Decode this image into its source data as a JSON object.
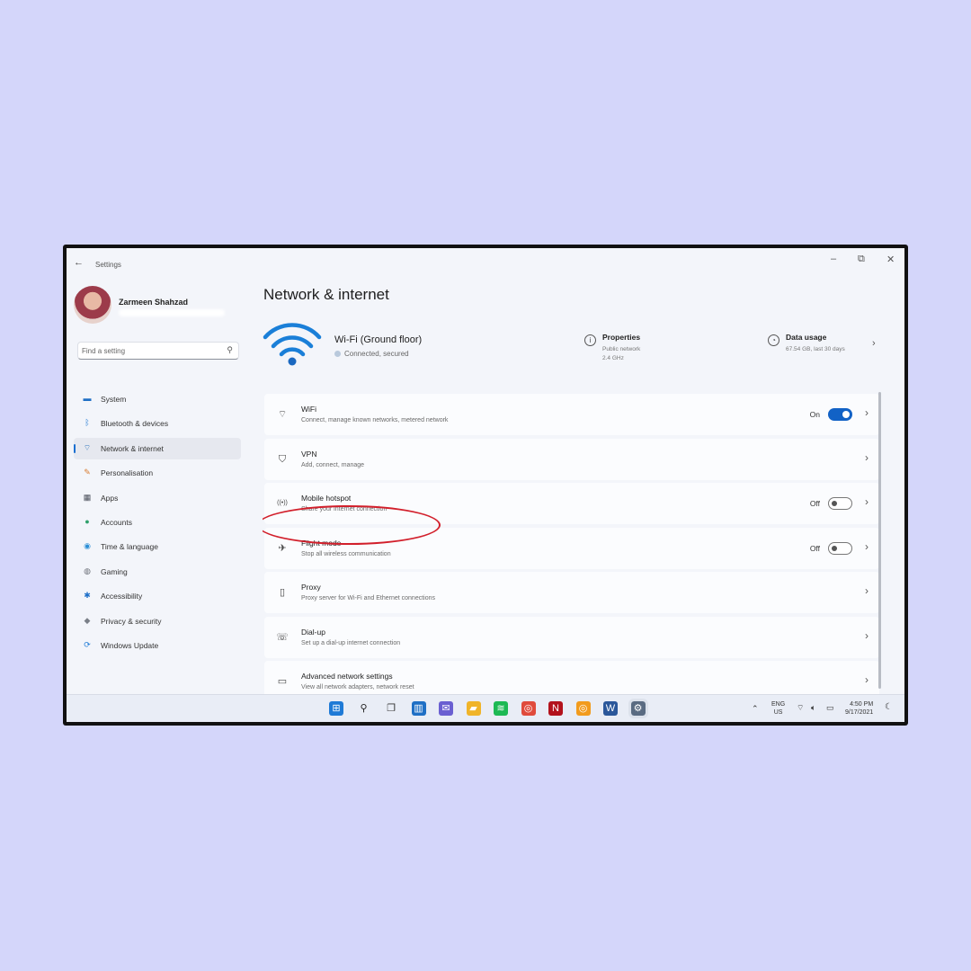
{
  "window": {
    "title": "Settings",
    "controls": {
      "minimize": "–",
      "maximize": "⧉",
      "close": "✕"
    }
  },
  "user": {
    "name": "Zarmeen Shahzad"
  },
  "search": {
    "placeholder": "Find a setting"
  },
  "sidebar": {
    "items": [
      {
        "label": "System",
        "icon": "monitor-icon",
        "color": "#1f6fc5"
      },
      {
        "label": "Bluetooth & devices",
        "icon": "bluetooth-icon",
        "color": "#2b7fd6"
      },
      {
        "label": "Network & internet",
        "icon": "wifi-icon",
        "color": "#1d6ab8",
        "active": true
      },
      {
        "label": "Personalisation",
        "icon": "brush-icon",
        "color": "#d87a2f"
      },
      {
        "label": "Apps",
        "icon": "apps-icon",
        "color": "#4a4f5a"
      },
      {
        "label": "Accounts",
        "icon": "person-icon",
        "color": "#2fa06b"
      },
      {
        "label": "Time & language",
        "icon": "globe-icon",
        "color": "#2b8fd6"
      },
      {
        "label": "Gaming",
        "icon": "gamepad-icon",
        "color": "#6b6f78"
      },
      {
        "label": "Accessibility",
        "icon": "accessibility-icon",
        "color": "#1e6fc8"
      },
      {
        "label": "Privacy & security",
        "icon": "shield-icon",
        "color": "#7a7f88"
      },
      {
        "label": "Windows Update",
        "icon": "update-icon",
        "color": "#1f7ad6"
      }
    ]
  },
  "main": {
    "title": "Network & internet",
    "wifi_header": {
      "name": "Wi-Fi (Ground floor)",
      "status": "Connected, secured"
    },
    "properties": {
      "title": "Properties",
      "line1": "Public network",
      "line2": "2.4 GHz"
    },
    "data_usage": {
      "title": "Data usage",
      "detail": "67.54 GB, last 30 days"
    },
    "cards": [
      {
        "title": "WiFi",
        "subtitle": "Connect, manage known networks, metered network",
        "icon": "wifi-icon",
        "state": "On",
        "toggle": true
      },
      {
        "title": "VPN",
        "subtitle": "Add, connect, manage",
        "icon": "vpn-shield-icon"
      },
      {
        "title": "Mobile hotspot",
        "subtitle": "Share your internet connection",
        "icon": "hotspot-icon",
        "state": "Off",
        "toggle": false
      },
      {
        "title": "Flight mode",
        "subtitle": "Stop all wireless communication",
        "icon": "airplane-icon",
        "state": "Off",
        "toggle": false
      },
      {
        "title": "Proxy",
        "subtitle": "Proxy server for Wi-Fi and Ethernet connections",
        "icon": "proxy-icon"
      },
      {
        "title": "Dial-up",
        "subtitle": "Set up a dial-up internet connection",
        "icon": "dialup-icon"
      },
      {
        "title": "Advanced network settings",
        "subtitle": "View all network adapters, network reset",
        "icon": "network-pc-icon"
      }
    ],
    "highlight_color": "#d21f2b"
  },
  "taskbar": {
    "apps": [
      {
        "name": "windows-start",
        "color": "#1f7ad6"
      },
      {
        "name": "search",
        "color": "#222222"
      },
      {
        "name": "task-view",
        "color": "#333333"
      },
      {
        "name": "widgets",
        "color": "#1f6fc5"
      },
      {
        "name": "teams-chat",
        "color": "#6a5fd1"
      },
      {
        "name": "file-explorer",
        "color": "#f0b429"
      },
      {
        "name": "spotify",
        "color": "#1db954"
      },
      {
        "name": "chrome",
        "color": "#e04b3c"
      },
      {
        "name": "netflix",
        "color": "#b3121c"
      },
      {
        "name": "chrome-canary",
        "color": "#f29b1d"
      },
      {
        "name": "word",
        "color": "#2b579a"
      },
      {
        "name": "settings",
        "color": "#5a6b82"
      }
    ],
    "language": {
      "line1": "ENG",
      "line2": "US"
    },
    "clock": {
      "time": "4:50 PM",
      "date": "9/17/2021"
    }
  }
}
